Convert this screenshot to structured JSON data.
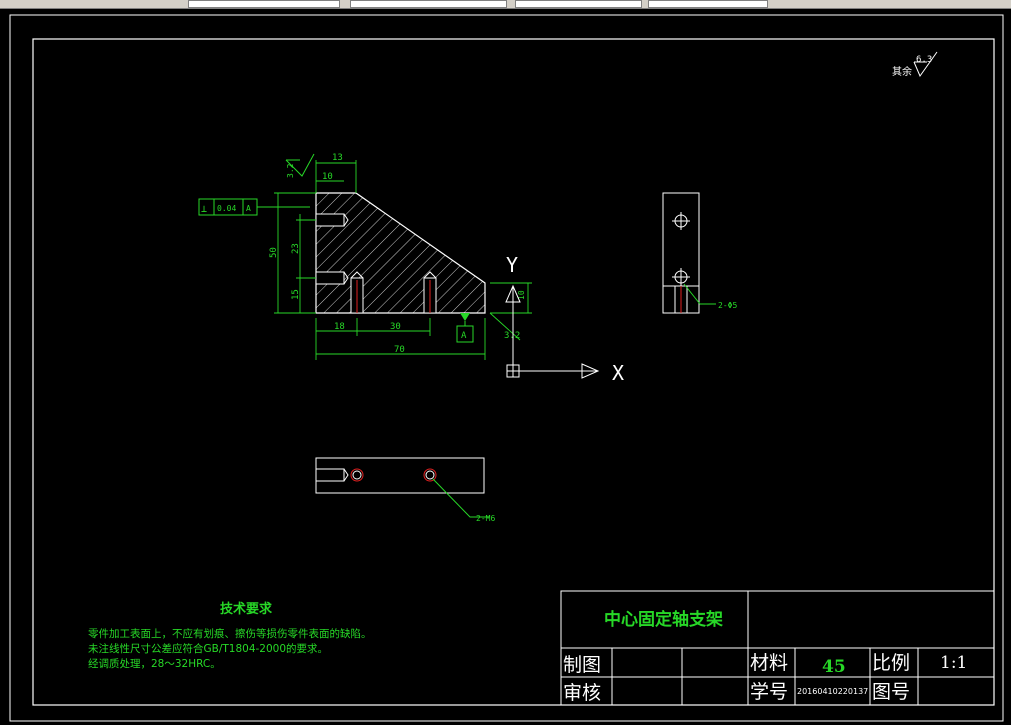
{
  "app": {
    "toolbar_fields": [
      "",
      "",
      "",
      "",
      ""
    ]
  },
  "drawing": {
    "roughness_note": {
      "prefix": "其余",
      "value": "6.3"
    },
    "dimensions": {
      "top_width": "13",
      "top_inner": "10",
      "left_total": "50",
      "left_upper": "23",
      "left_lower": "15",
      "bottom_left": "18",
      "bottom_mid": "30",
      "bottom_total": "70",
      "right_small": "3.2",
      "right_v": "10"
    },
    "tolerance_frame": {
      "symbol": "⊥",
      "value": "0.04",
      "datum": "A"
    },
    "datum_label": "A",
    "surface_roughness_left": "3.2",
    "axis_labels": {
      "y": "Y",
      "x": "X"
    },
    "side_view_hole_note": "2-Φ5",
    "top_view_hole_note": "2-M6"
  },
  "tech_requirements": {
    "title": "技术要求",
    "lines": [
      "零件加工表面上，不应有划痕、擦伤等损伤零件表面的缺陷。",
      "未注线性尺寸公差应符合GB/T1804-2000的要求。",
      "经调质处理，28～32HRC。"
    ]
  },
  "title_block": {
    "part_name": "中心固定轴支架",
    "drawn_by_label": "制图",
    "checked_by_label": "审核",
    "material_label": "材料",
    "material_value": "45",
    "scale_label": "比例",
    "scale_value": "1:1",
    "student_id_label": "学号",
    "student_id_value": "20160410220137",
    "drawing_no_label": "图号"
  }
}
